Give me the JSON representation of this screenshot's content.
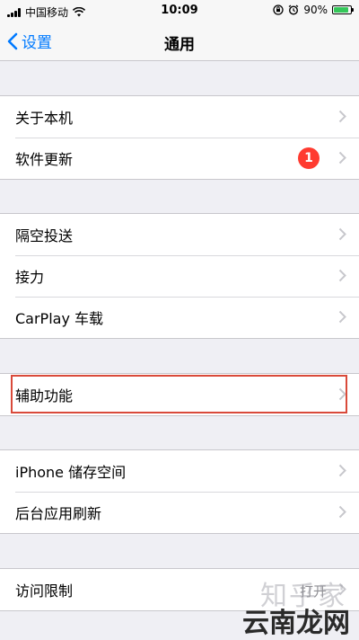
{
  "status_bar": {
    "carrier": "中国移动",
    "time": "10:09",
    "battery": "90%",
    "battery_level": 0.9
  },
  "nav": {
    "back_label": "设置",
    "title": "通用"
  },
  "groups": [
    {
      "items": [
        {
          "label": "关于本机"
        },
        {
          "label": "软件更新",
          "badge": "1"
        }
      ]
    },
    {
      "items": [
        {
          "label": "隔空投送"
        },
        {
          "label": "接力"
        },
        {
          "label": "CarPlay 车载"
        }
      ]
    },
    {
      "items": [
        {
          "label": "辅助功能"
        }
      ]
    },
    {
      "items": [
        {
          "label": "iPhone 储存空间"
        },
        {
          "label": "后台应用刷新"
        }
      ]
    },
    {
      "items": [
        {
          "label": "访问限制",
          "value": "打开"
        }
      ]
    }
  ],
  "watermark": {
    "line1": "知乎家",
    "line2": "云南龙网"
  },
  "colors": {
    "accent": "#007aff",
    "badge": "#ff3b30",
    "highlight": "#d94a3a",
    "battery": "#34c759"
  }
}
